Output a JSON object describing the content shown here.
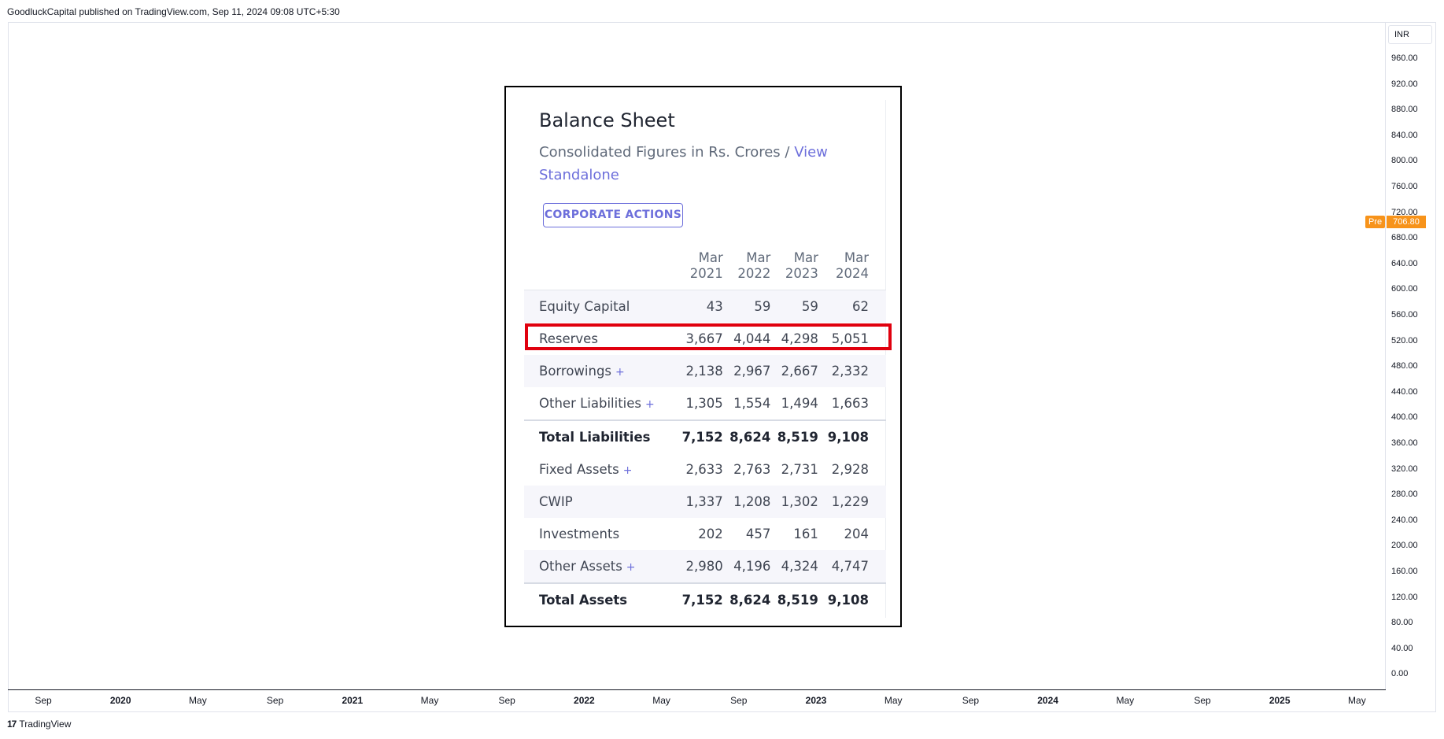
{
  "header": {
    "text": "GoodluckCapital published on TradingView.com, Sep 11, 2024 09:08 UTC+5:30"
  },
  "price_axis": {
    "currency": "INR",
    "labels": [
      "960.00",
      "920.00",
      "880.00",
      "840.00",
      "800.00",
      "760.00",
      "720.00",
      "680.00",
      "640.00",
      "600.00",
      "560.00",
      "520.00",
      "480.00",
      "440.00",
      "400.00",
      "360.00",
      "320.00",
      "280.00",
      "240.00",
      "200.00",
      "160.00",
      "120.00",
      "80.00",
      "40.00",
      "0.00"
    ],
    "pre_label": "Pre",
    "current_price": "706.80",
    "badge_color": "#f7931a"
  },
  "time_axis": {
    "labels": [
      {
        "text": "Sep",
        "major": false
      },
      {
        "text": "2020",
        "major": true
      },
      {
        "text": "May",
        "major": false
      },
      {
        "text": "Sep",
        "major": false
      },
      {
        "text": "2021",
        "major": true
      },
      {
        "text": "May",
        "major": false
      },
      {
        "text": "Sep",
        "major": false
      },
      {
        "text": "2022",
        "major": true
      },
      {
        "text": "May",
        "major": false
      },
      {
        "text": "Sep",
        "major": false
      },
      {
        "text": "2023",
        "major": true
      },
      {
        "text": "May",
        "major": false
      },
      {
        "text": "Sep",
        "major": false
      },
      {
        "text": "2024",
        "major": true
      },
      {
        "text": "May",
        "major": false
      },
      {
        "text": "Sep",
        "major": false
      },
      {
        "text": "2025",
        "major": true
      },
      {
        "text": "May",
        "major": false
      }
    ]
  },
  "footer": {
    "logo": "17",
    "brand": "TradingView"
  },
  "balance_sheet": {
    "title": "Balance Sheet",
    "subtitle": "Consolidated Figures in Rs. Crores / ",
    "link_text": "View Standalone",
    "button_label": "CORPORATE ACTIONS",
    "columns": [
      [
        "Mar",
        "2021"
      ],
      [
        "Mar",
        "2022"
      ],
      [
        "Mar",
        "2023"
      ],
      [
        "Mar",
        "2024"
      ]
    ],
    "rows": [
      {
        "label": "Equity Capital",
        "plus": false,
        "total": false,
        "values": [
          "43",
          "59",
          "59",
          "62"
        ]
      },
      {
        "label": "Reserves",
        "plus": false,
        "total": false,
        "values": [
          "3,667",
          "4,044",
          "4,298",
          "5,051"
        ]
      },
      {
        "label": "Borrowings",
        "plus": true,
        "total": false,
        "values": [
          "2,138",
          "2,967",
          "2,667",
          "2,332"
        ]
      },
      {
        "label": "Other Liabilities",
        "plus": true,
        "total": false,
        "values": [
          "1,305",
          "1,554",
          "1,494",
          "1,663"
        ]
      },
      {
        "label": "Total Liabilities",
        "plus": false,
        "total": true,
        "values": [
          "7,152",
          "8,624",
          "8,519",
          "9,108"
        ]
      },
      {
        "label": "Fixed Assets",
        "plus": true,
        "total": false,
        "values": [
          "2,633",
          "2,763",
          "2,731",
          "2,928"
        ]
      },
      {
        "label": "CWIP",
        "plus": false,
        "total": false,
        "values": [
          "1,337",
          "1,208",
          "1,302",
          "1,229"
        ]
      },
      {
        "label": "Investments",
        "plus": false,
        "total": false,
        "values": [
          "202",
          "457",
          "161",
          "204"
        ]
      },
      {
        "label": "Other Assets",
        "plus": true,
        "total": false,
        "values": [
          "2,980",
          "4,196",
          "4,324",
          "4,747"
        ]
      },
      {
        "label": "Total Assets",
        "plus": false,
        "total": true,
        "values": [
          "7,152",
          "8,624",
          "8,519",
          "9,108"
        ]
      }
    ],
    "plus_glyph": "+",
    "highlight_color": "#e0000e"
  }
}
